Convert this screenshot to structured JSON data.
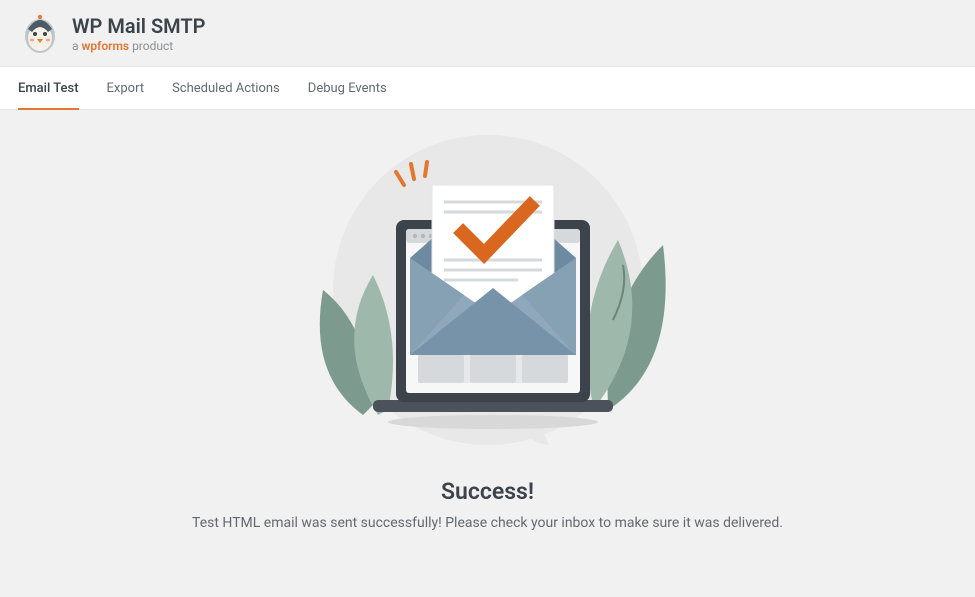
{
  "header": {
    "brand": "WP Mail SMTP",
    "subbrand_prefix": "a ",
    "subbrand_accent": "wpforms",
    "subbrand_suffix": " product"
  },
  "tabs": [
    {
      "label": "Email Test",
      "active": true
    },
    {
      "label": "Export",
      "active": false
    },
    {
      "label": "Scheduled Actions",
      "active": false
    },
    {
      "label": "Debug Events",
      "active": false
    }
  ],
  "result": {
    "title": "Success!",
    "message": "Test HTML email was sent successfully! Please check your inbox to make sure it was delivered."
  }
}
